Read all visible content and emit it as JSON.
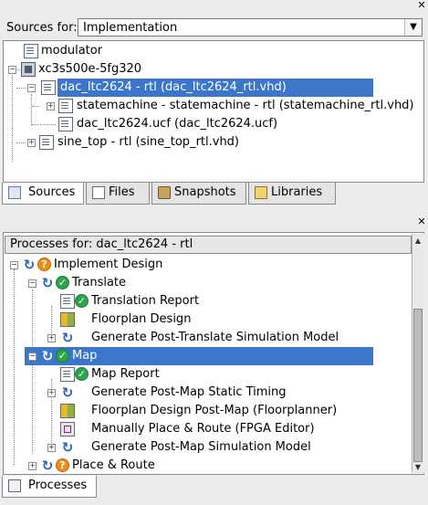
{
  "sources": {
    "label": "Sources for:",
    "combo_value": "Implementation",
    "tree": [
      {
        "label": "modulator"
      },
      {
        "label": "xc3s500e-5fg320"
      },
      {
        "label": "dac_ltc2624 - rtl (dac_ltc2624_rtl.vhd)"
      },
      {
        "label": "statemachine - statemachine - rtl (statemachine_rtl.vhd)"
      },
      {
        "label": "dac_ltc2624.ucf (dac_ltc2624.ucf)"
      },
      {
        "label": "sine_top - rtl (sine_top_rtl.vhd)"
      }
    ],
    "tabs": [
      {
        "label": "Sources"
      },
      {
        "label": "Files"
      },
      {
        "label": "Snapshots"
      },
      {
        "label": "Libraries"
      }
    ]
  },
  "processes": {
    "header": "Processes for: dac_ltc2624 - rtl",
    "tree": [
      {
        "label": "Implement Design"
      },
      {
        "label": "Translate"
      },
      {
        "label": "Translation Report"
      },
      {
        "label": "Floorplan Design"
      },
      {
        "label": "Generate Post-Translate Simulation Model"
      },
      {
        "label": "Map"
      },
      {
        "label": "Map Report"
      },
      {
        "label": "Generate Post-Map Static Timing"
      },
      {
        "label": "Floorplan Design Post-Map (Floorplanner)"
      },
      {
        "label": "Manually Place & Route (FPGA Editor)"
      },
      {
        "label": "Generate Post-Map Simulation Model"
      },
      {
        "label": "Place & Route"
      }
    ],
    "tab": "Processes"
  },
  "colors": {
    "selection": "#3c76c9",
    "ok": "#2da34a",
    "warn": "#f08c1a",
    "run": "#2b61b8"
  }
}
